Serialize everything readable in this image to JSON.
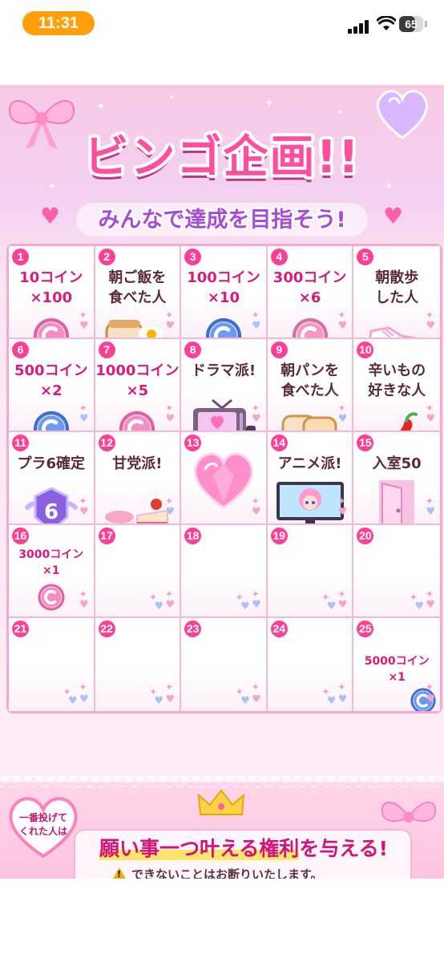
{
  "status_bar": {
    "time": "11:31",
    "battery": "65",
    "battery_level": 0.65
  },
  "poster": {
    "title": "ビンゴ企画!!",
    "subtitle": "みんなで達成を目指そう!",
    "cells": [
      {
        "num": "1",
        "text": "10コイン\n×100",
        "icon": "coin-pink-icon"
      },
      {
        "num": "2",
        "text": "朝ご飯を\n食べた人",
        "icon": "breakfast-icon"
      },
      {
        "num": "3",
        "text": "100コイン\n×10",
        "icon": "coin-blue-icon"
      },
      {
        "num": "4",
        "text": "300コイン\n×6",
        "icon": "coin-rose-icon"
      },
      {
        "num": "5",
        "text": "朝散歩\nした人",
        "icon": "sneaker-icon"
      },
      {
        "num": "6",
        "text": "500コイン\n×2",
        "icon": "coin-blue-icon"
      },
      {
        "num": "7",
        "text": "1000コイン\n×5",
        "icon": "coin-pink-icon"
      },
      {
        "num": "8",
        "text": "ドラマ派!",
        "icon": "tv-icon"
      },
      {
        "num": "9",
        "text": "朝パンを\n食べた人",
        "icon": "bread-icon"
      },
      {
        "num": "10",
        "text": "辛いもの\n好きな人",
        "icon": "chili-pepper-icon"
      },
      {
        "num": "11",
        "text": "プラ6確定",
        "icon": "rank-badge-icon",
        "badge": "6"
      },
      {
        "num": "12",
        "text": "甘党派!",
        "icon": "sweets-icon"
      },
      {
        "num": "13",
        "text": "",
        "icon": "heart-gem-icon"
      },
      {
        "num": "14",
        "text": "アニメ派!",
        "icon": "anime-monitor-icon"
      },
      {
        "num": "15",
        "text": "入室50",
        "icon": "door-icon"
      },
      {
        "num": "16",
        "text": "3000コイン\n×1",
        "icon": "coin-pink-icon"
      },
      {
        "num": "17",
        "text": "",
        "icon": ""
      },
      {
        "num": "18",
        "text": "",
        "icon": ""
      },
      {
        "num": "19",
        "text": "",
        "icon": ""
      },
      {
        "num": "20",
        "text": "",
        "icon": ""
      },
      {
        "num": "21",
        "text": "",
        "icon": ""
      },
      {
        "num": "22",
        "text": "",
        "icon": ""
      },
      {
        "num": "23",
        "text": "",
        "icon": ""
      },
      {
        "num": "24",
        "text": "",
        "icon": ""
      },
      {
        "num": "25",
        "text": "5000コイン\n×1",
        "icon": "coin-blue-icon"
      }
    ],
    "banner": {
      "heart_text": "一番投げて\nくれた人は",
      "main_pre": "願い事",
      "main_highlight": "一つ叶える権利",
      "main_post": "を与える!",
      "note": "できないことはお断りいたします。"
    },
    "colors": {
      "accent": "#ff3f95",
      "title": "#ff4da0",
      "subtitle": "#a64bd6",
      "coin_pink": "#f27ab8",
      "coin_blue": "#5f8fe8"
    }
  }
}
